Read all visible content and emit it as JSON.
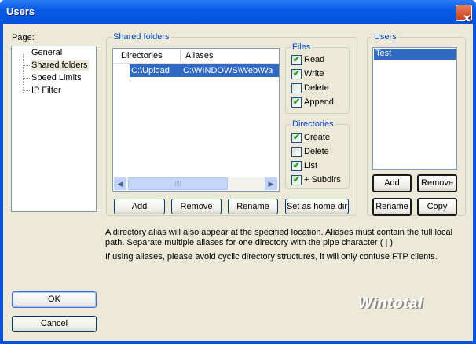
{
  "window": {
    "title": "Users"
  },
  "page_label": "Page:",
  "tree": [
    "General",
    "Shared folders",
    "Speed Limits",
    "IP Filter"
  ],
  "shared": {
    "title": "Shared folders",
    "columns": [
      "Directories",
      "Aliases"
    ],
    "rows": [
      {
        "directory": "C:\\Upload",
        "alias": "C:\\WINDOWS\\Web\\Wa"
      }
    ],
    "buttons": [
      "Add",
      "Remove",
      "Rename",
      "Set as home dir"
    ]
  },
  "files": {
    "title": "Files",
    "items": [
      {
        "label": "Read",
        "checked": true
      },
      {
        "label": "Write",
        "checked": true
      },
      {
        "label": "Delete",
        "checked": false
      },
      {
        "label": "Append",
        "checked": true
      }
    ]
  },
  "directories": {
    "title": "Directories",
    "items": [
      {
        "label": "Create",
        "checked": true
      },
      {
        "label": "Delete",
        "checked": false
      },
      {
        "label": "List",
        "checked": true
      },
      {
        "label": "+ Subdirs",
        "checked": true
      }
    ]
  },
  "users": {
    "title": "Users",
    "list": [
      "Test"
    ],
    "buttons": [
      "Add",
      "Remove",
      "Rename",
      "Copy"
    ]
  },
  "info": [
    "A directory alias will also appear at the specified location. Aliases must contain the full local",
    "path. Separate multiple aliases for one directory with the pipe character ( | )",
    "If using aliases, please avoid cyclic directory structures, it will only confuse FTP clients."
  ],
  "ok": "OK",
  "cancel": "Cancel",
  "logo": "Wintotal"
}
